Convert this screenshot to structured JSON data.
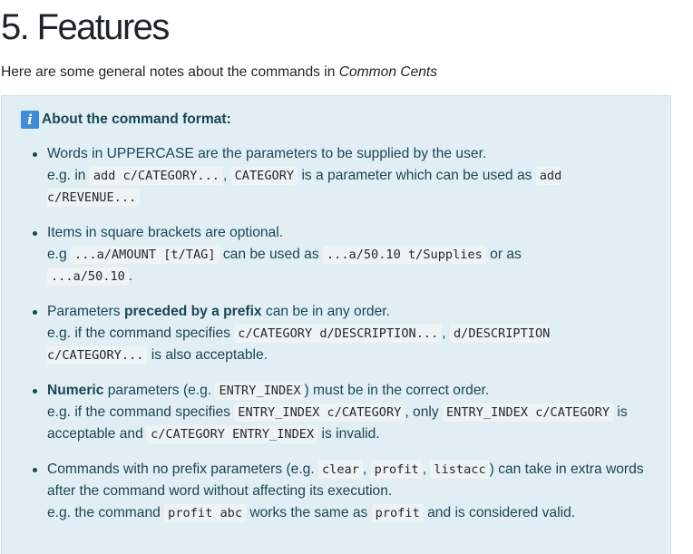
{
  "page": {
    "title": "5. Features",
    "intro_text": "Here are some general notes about the commands in ",
    "intro_em": "Common Cents"
  },
  "callout": {
    "icon": "information-icon",
    "icon_glyph": "i",
    "accent_color": "#3d8bd9",
    "background_color": "#e1eff5",
    "heading": "About the command format:"
  },
  "notes": [
    {
      "t1": "Words in UPPERCASE are the parameters to be supplied by the user.",
      "t2": "e.g. in ",
      "c1": "add c/CATEGORY...",
      "t3": ", ",
      "c2": "CATEGORY",
      "t4": " is a parameter which can be used as ",
      "c3": "add c/REVENUE..."
    },
    {
      "t1": "Items in square brackets are optional.",
      "t2": "e.g ",
      "c1": "...a/AMOUNT [t/TAG]",
      "t3": " can be used as ",
      "c2": "...a/50.10 t/Supplies",
      "t4": " or as ",
      "c3": "...a/50.10",
      "t5": "."
    },
    {
      "t1": "Parameters ",
      "b1": "preceded by a prefix",
      "t2": " can be in any order.",
      "t3": "e.g. if the command specifies ",
      "c1": "c/CATEGORY d/DESCRIPTION...",
      "t4": ", ",
      "c2": "d/DESCRIPTION c/CATEGORY...",
      "t5": " is also acceptable."
    },
    {
      "b1": "Numeric",
      "t1": " parameters (e.g. ",
      "c1": "ENTRY_INDEX",
      "t2": ") must be in the correct order.",
      "t3": "e.g. if the command specifies ",
      "c2": "ENTRY_INDEX c/CATEGORY",
      "t4": ", only ",
      "c3": "ENTRY_INDEX c/CATEGORY",
      "t5": " is acceptable and ",
      "c4": "c/CATEGORY ENTRY_INDEX",
      "t6": " is invalid."
    },
    {
      "t1": "Commands with no prefix parameters (e.g. ",
      "c1": "clear",
      "t2": ", ",
      "c2": "profit",
      "t3": ", ",
      "c3": "listacc",
      "t4": ") can take in extra words after the command word without affecting its execution.",
      "t5": "e.g. the command ",
      "c4": "profit abc",
      "t6": " works the same as ",
      "c5": "profit",
      "t7": " and is considered valid."
    }
  ]
}
